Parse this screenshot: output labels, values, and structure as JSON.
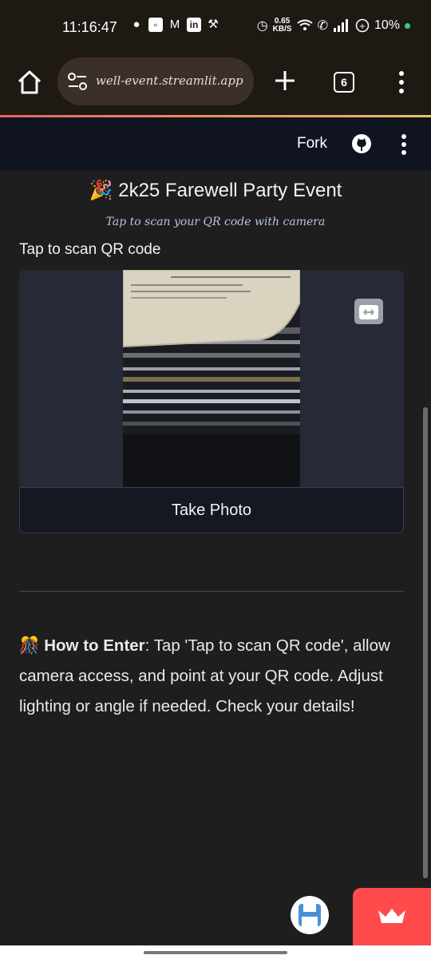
{
  "status_bar": {
    "time": "11:16:47",
    "net_speed_value": "0.65",
    "net_speed_unit": "KB/S",
    "battery": "10%",
    "icons": [
      "snapchat-icon",
      "app-icon",
      "gmail-icon",
      "linkedin-icon",
      "wrench-icon",
      "alarm-icon",
      "wifi-icon",
      "wifi-calling-icon",
      "signal-icon",
      "battery-icon"
    ]
  },
  "browser": {
    "url": "well-event.streamlit.app",
    "tab_count": "6"
  },
  "app_header": {
    "fork_label": "Fork"
  },
  "main": {
    "title_emoji": "🎉",
    "title": "2k25 Farewell Party Event",
    "subtitle": "Tap to scan your QR code with camera",
    "camera_label": "Tap to scan QR code",
    "take_photo_label": "Take Photo",
    "howto_emoji": "🎊",
    "howto_bold": "How to Enter",
    "howto_text": ": Tap 'Tap to scan QR code', allow camera access, and point at your QR code. Adjust lighting or angle if needed. Check your details!"
  },
  "colors": {
    "accent_red": "#ff4b4b",
    "header_bg": "#0f1420",
    "page_bg": "#1e1e1e"
  }
}
